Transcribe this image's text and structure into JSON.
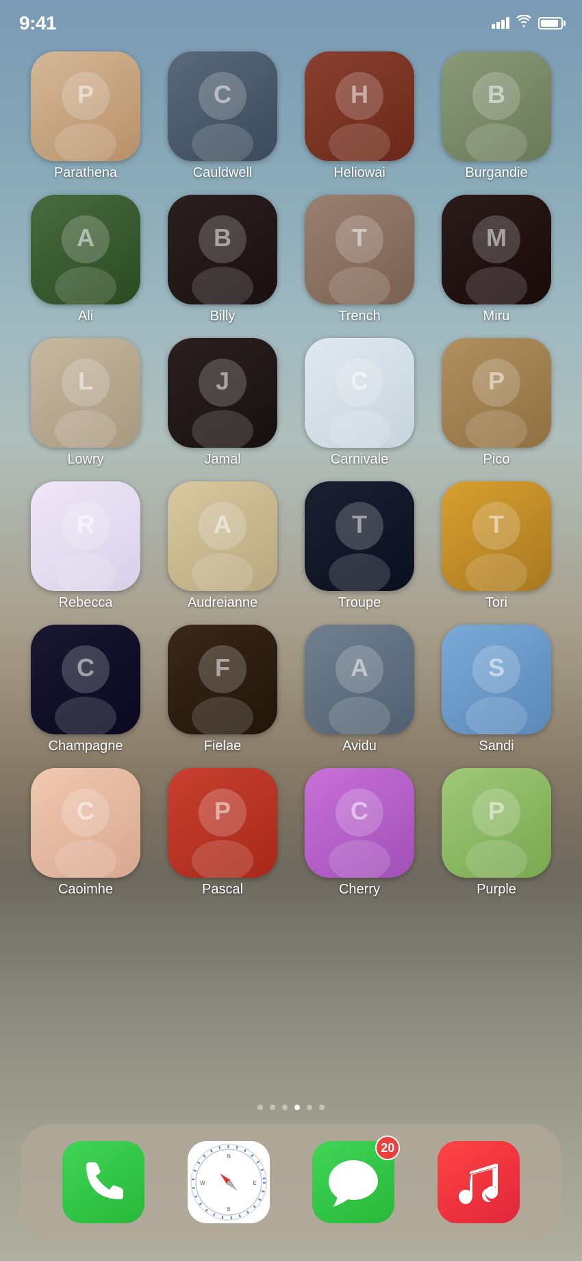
{
  "statusBar": {
    "time": "9:41",
    "signalBars": 4,
    "batteryPercent": 90
  },
  "contacts": [
    {
      "name": "Parathena",
      "color": "#c8a882",
      "initial": "P",
      "gradient": [
        "#d4b896",
        "#c8a070"
      ]
    },
    {
      "name": "Cauldwell",
      "color": "#4a5a6a",
      "initial": "C",
      "gradient": [
        "#6a7a8a",
        "#3a4a5a"
      ]
    },
    {
      "name": "Heliowai",
      "color": "#8a4030",
      "initial": "H",
      "gradient": [
        "#c05040",
        "#7a3025"
      ]
    },
    {
      "name": "Burgandie",
      "color": "#7a8a60",
      "initial": "B",
      "gradient": [
        "#8a9a70",
        "#6a7a50"
      ]
    },
    {
      "name": "Ali",
      "color": "#4a6a40",
      "initial": "A",
      "gradient": [
        "#5a7a50",
        "#3a5a30"
      ]
    },
    {
      "name": "Billy",
      "color": "#3a3a3a",
      "initial": "B",
      "gradient": [
        "#4a4a4a",
        "#2a2a2a"
      ]
    },
    {
      "name": "Trench",
      "color": "#8a7060",
      "initial": "T",
      "gradient": [
        "#9a8070",
        "#7a6050"
      ]
    },
    {
      "name": "Miru",
      "color": "#2a2a2a",
      "initial": "M",
      "gradient": [
        "#3a3a3a",
        "#1a1a1a"
      ]
    },
    {
      "name": "Lowry",
      "color": "#c0b0a0",
      "initial": "L",
      "gradient": [
        "#d0c0b0",
        "#b0a090"
      ]
    },
    {
      "name": "Jamal",
      "color": "#2a2a2a",
      "initial": "J",
      "gradient": [
        "#3a3a3a",
        "#1a1a1a"
      ]
    },
    {
      "name": "Carnivale",
      "color": "#e0e8f0",
      "initial": "C",
      "gradient": [
        "#eef4f8",
        "#d0d8e0"
      ]
    },
    {
      "name": "Pico",
      "color": "#c0a870",
      "initial": "P",
      "gradient": [
        "#d0b880",
        "#b09860"
      ]
    },
    {
      "name": "Rebecca",
      "color": "#e8e0f0",
      "initial": "R",
      "gradient": [
        "#f0e8f8",
        "#d8d0e8"
      ]
    },
    {
      "name": "Audreianne",
      "color": "#d0c8a0",
      "initial": "A",
      "gradient": [
        "#e0d8b0",
        "#c0b890"
      ]
    },
    {
      "name": "Troupe",
      "color": "#1a2a4a",
      "initial": "T",
      "gradient": [
        "#2a3a5a",
        "#0a1a3a"
      ]
    },
    {
      "name": "Tori",
      "color": "#c8902a",
      "initial": "T",
      "gradient": [
        "#d8a030",
        "#b88020"
      ]
    },
    {
      "name": "Champagne",
      "color": "#1a1a2a",
      "initial": "C",
      "gradient": [
        "#2a2a3a",
        "#0a0a1a"
      ]
    },
    {
      "name": "Fielae",
      "color": "#3a2a1a",
      "initial": "F",
      "gradient": [
        "#4a3a2a",
        "#2a1a0a"
      ]
    },
    {
      "name": "Avidu",
      "color": "#5a6a7a",
      "initial": "A",
      "gradient": [
        "#6a7a8a",
        "#4a5a6a"
      ]
    },
    {
      "name": "Sandi",
      "color": "#6a9ac0",
      "initial": "S",
      "gradient": [
        "#7aaad0",
        "#5a8ab0"
      ]
    },
    {
      "name": "Caoimhe",
      "color": "#f0c0a0",
      "initial": "C",
      "gradient": [
        "#f8d0b0",
        "#e0b090"
      ]
    },
    {
      "name": "Pascal",
      "color": "#c04030",
      "initial": "P",
      "gradient": [
        "#d05040",
        "#b03020"
      ]
    },
    {
      "name": "Cherry",
      "color": "#c870d0",
      "initial": "C",
      "gradient": [
        "#d880e0",
        "#b860c0"
      ]
    },
    {
      "name": "Purple",
      "color": "#a0c080",
      "initial": "P",
      "gradient": [
        "#b0d090",
        "#90b070"
      ]
    }
  ],
  "pageDots": {
    "total": 6,
    "active": 4
  },
  "dock": {
    "phone": {
      "label": "Phone",
      "badgeCount": null
    },
    "safari": {
      "label": "Safari",
      "badgeCount": null
    },
    "messages": {
      "label": "Messages",
      "badgeCount": "20"
    },
    "music": {
      "label": "Music",
      "badgeCount": null
    }
  }
}
